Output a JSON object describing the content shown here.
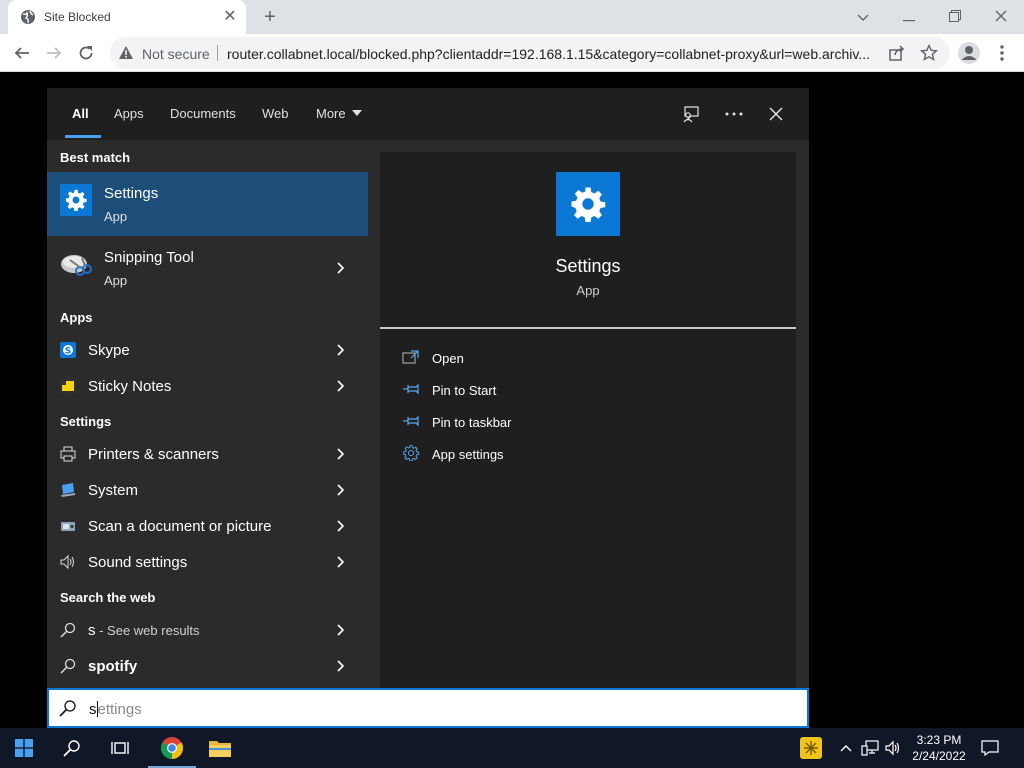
{
  "browser": {
    "tab_title": "Site Blocked",
    "tab_close": "✕",
    "new_tab": "+",
    "security_label": "Not secure",
    "url": "router.collabnet.local/blocked.php?clientaddr=192.168.1.15&category=collabnet-proxy&url=web.archiv..."
  },
  "panel": {
    "tabs": [
      {
        "label": "All"
      },
      {
        "label": "Apps"
      },
      {
        "label": "Documents"
      },
      {
        "label": "Web"
      },
      {
        "label": "More"
      }
    ],
    "best_match_header": "Best match",
    "best_matches": [
      {
        "title": "Settings",
        "subtitle": "App",
        "icon": "settings-gear-icon"
      },
      {
        "title": "Snipping Tool",
        "subtitle": "App",
        "icon": "snipping-tool-icon"
      }
    ],
    "apps_header": "Apps",
    "apps": [
      {
        "label": "Skype",
        "icon": "skype-icon"
      },
      {
        "label": "Sticky Notes",
        "icon": "sticky-notes-icon"
      }
    ],
    "settings_header": "Settings",
    "settings": [
      {
        "label": "Printers & scanners",
        "icon": "printer-icon"
      },
      {
        "label": "System",
        "icon": "laptop-icon"
      },
      {
        "label": "Scan a document or picture",
        "icon": "scanner-icon"
      },
      {
        "label": "Sound settings",
        "icon": "speaker-icon"
      }
    ],
    "web_header": "Search the web",
    "web": [
      {
        "query": "s",
        "suffix": " - See web results"
      },
      {
        "query": "spotify",
        "suffix": ""
      }
    ],
    "detail": {
      "title": "Settings",
      "subtitle": "App",
      "actions": [
        {
          "label": "Open",
          "icon": "open-icon"
        },
        {
          "label": "Pin to Start",
          "icon": "pin-icon"
        },
        {
          "label": "Pin to taskbar",
          "icon": "pin-icon"
        },
        {
          "label": "App settings",
          "icon": "gear-icon"
        }
      ]
    }
  },
  "search": {
    "typed": "s",
    "suggestion_rest": "ettings"
  },
  "taskbar": {
    "time": "3:23 PM",
    "date": "2/24/2022"
  },
  "colors": {
    "accent": "#0a78d4",
    "selected_row": "#1d4e79",
    "panel_bg": "#2b2b2b",
    "taskbar_bg": "#101828"
  }
}
